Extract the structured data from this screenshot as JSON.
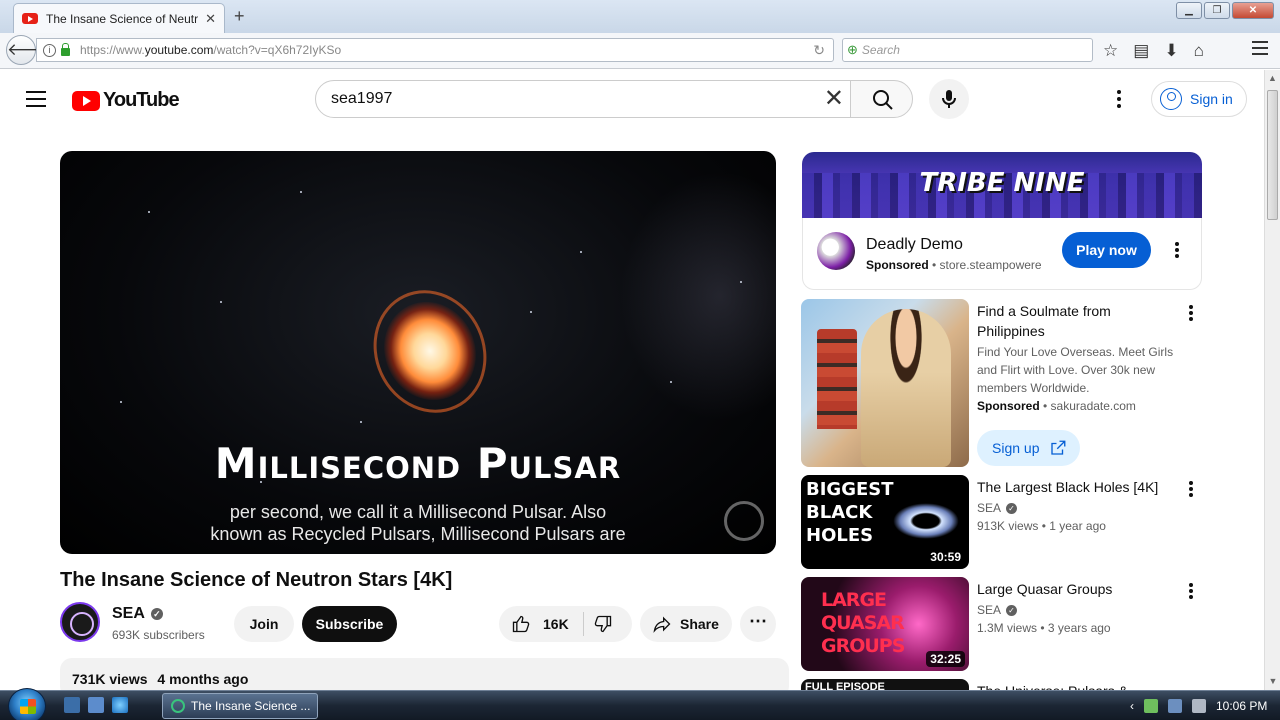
{
  "browser": {
    "tab_title": "The Insane Science of Neutr",
    "tab_close": "✕",
    "new_tab": "+",
    "url_prefix": "https://www.",
    "url_domain": "youtube.com",
    "url_path": "/watch?v=qX6h72IyKSo",
    "search_placeholder": "Search",
    "window_min": "▁",
    "window_max": "❐",
    "window_close": "✕"
  },
  "header": {
    "logo_text": "YouTube",
    "search_value": "sea1997",
    "sign_in": "Sign in"
  },
  "player": {
    "overlay_title": "Millisecond Pulsar",
    "caption_line1": "per second, we call it a Millisecond Pulsar. Also",
    "caption_line2": "known as Recycled Pulsars, Millisecond Pulsars are"
  },
  "video": {
    "title": "The Insane Science of Neutron Stars [4K]",
    "channel": "SEA",
    "subscribers": "693K subscribers",
    "join": "Join",
    "subscribe": "Subscribe",
    "likes": "16K",
    "share": "Share",
    "views": "731K views",
    "age": "4 months ago"
  },
  "sidebar": {
    "banner_text": "TRIBE NINE",
    "ad": {
      "name": "Deadly Demo",
      "sponsored": "Sponsored",
      "domain": "store.steampowere",
      "cta": "Play now"
    },
    "promo": {
      "title": "Find a Soulmate from Philippines",
      "description": "Find Your Love Overseas. Meet Girls and Flirt with Love. Over 30k new members Worldwide.",
      "sponsored": "Sponsored",
      "domain": "sakuradate.com",
      "cta": "Sign up"
    },
    "recs": [
      {
        "title": "The Largest Black Holes [4K]",
        "channel": "SEA",
        "meta": "913K views • 1 year ago",
        "duration": "30:59",
        "thumb_text": "BIGGEST BLACK HOLES"
      },
      {
        "title": "Large Quasar Groups",
        "channel": "SEA",
        "meta": "1.3M views • 3 years ago",
        "duration": "32:25",
        "thumb_text": "LARGE QUASAR GROUPS"
      },
      {
        "title": "The Universe: Pulsars &",
        "thumb_text": "FULL EPISODE"
      }
    ]
  },
  "taskbar": {
    "window_title": "The Insane Science ...",
    "clock": "10:06 PM"
  },
  "colors": {
    "youtube_red": "#ff0000",
    "link_blue": "#065fd4",
    "text": "#0f0f0f",
    "secondary_text": "#606060"
  }
}
